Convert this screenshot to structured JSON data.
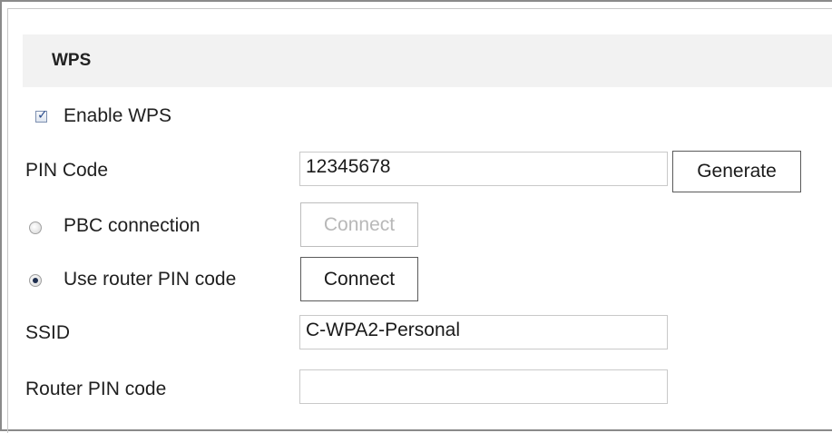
{
  "section": {
    "title": "WPS"
  },
  "enable_wps": {
    "label": "Enable WPS",
    "checked": true
  },
  "pin_code": {
    "label": "PIN Code",
    "value": "12345678",
    "generate_label": "Generate"
  },
  "pbc": {
    "label": "PBC connection",
    "selected": false,
    "connect_label": "Connect",
    "connect_enabled": false
  },
  "router_pin": {
    "label": "Use router PIN code",
    "selected": true,
    "connect_label": "Connect",
    "connect_enabled": true
  },
  "ssid": {
    "label": "SSID",
    "value": "C-WPA2-Personal"
  },
  "router_pin_code": {
    "label": "Router PIN code",
    "value": ""
  },
  "icons": {
    "checkbox": "checkbox-checked-icon",
    "radio_off": "radio-unselected-icon",
    "radio_on": "radio-selected-icon"
  },
  "colors": {
    "header_bg": "#f2f2f2",
    "disabled_text": "#b8b8b8",
    "border": "#8a8a8a"
  }
}
